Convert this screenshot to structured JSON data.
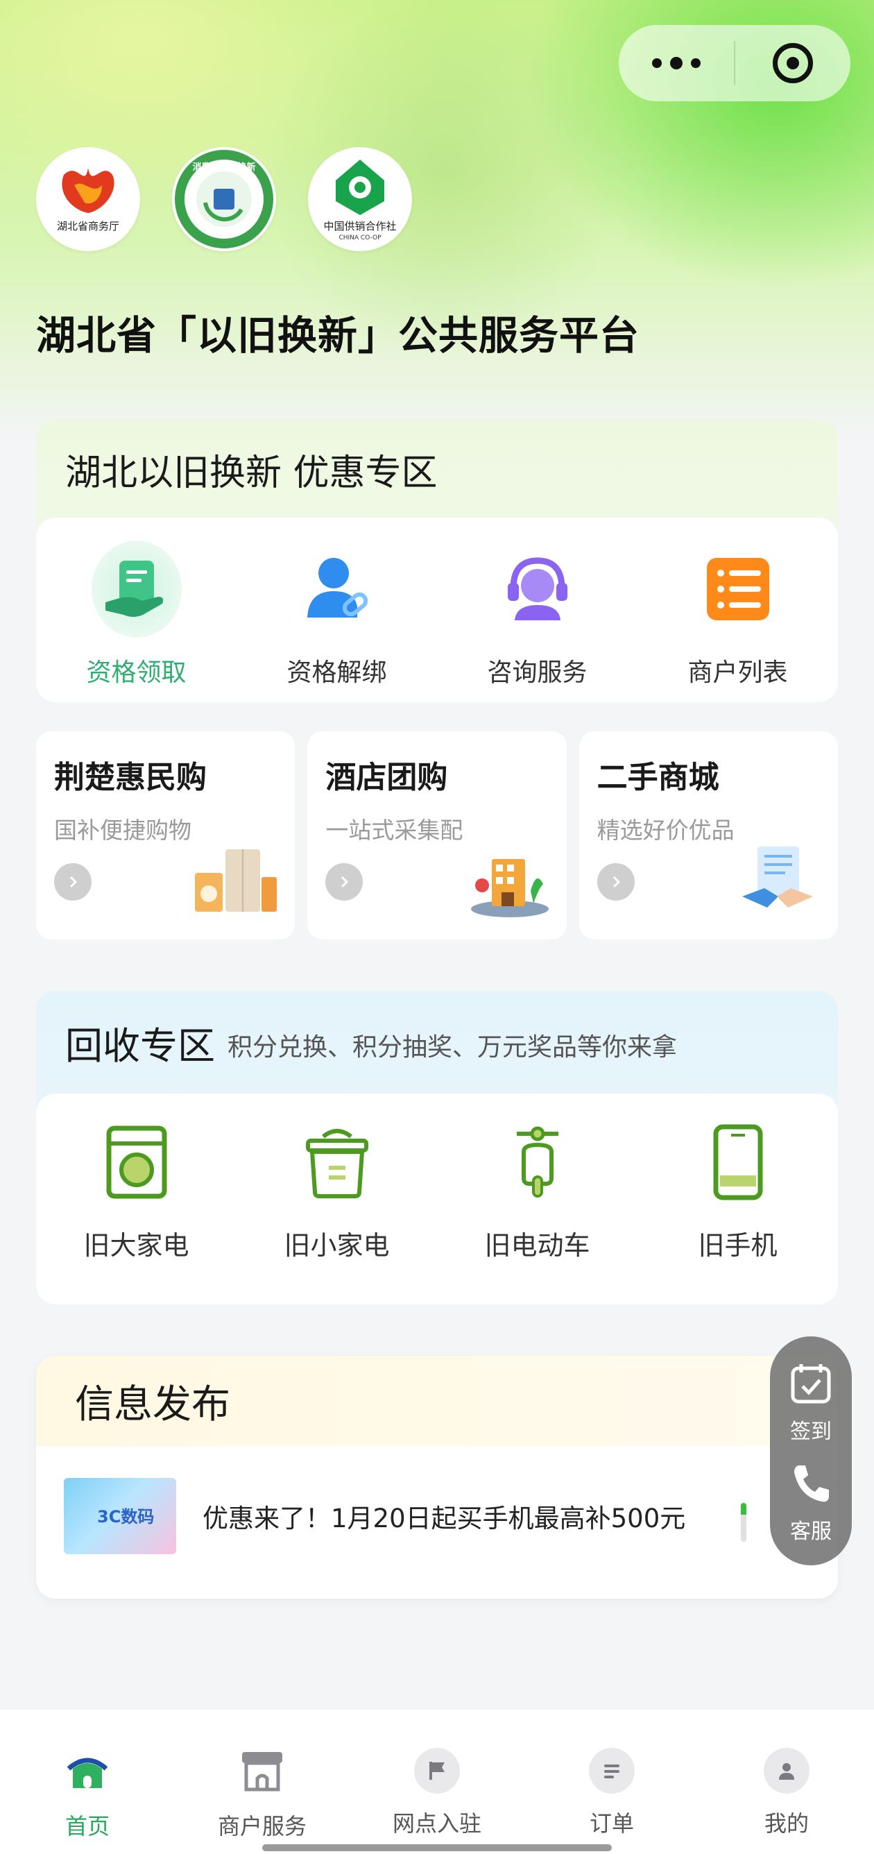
{
  "header": {
    "site_title": "湖北省「以旧换新」公共服务平台",
    "logos": [
      {
        "name": "hubei-commerce-logo",
        "caption": "湖北省商务厅"
      },
      {
        "name": "trade-in-program-logo",
        "caption": "消费品以旧换新"
      },
      {
        "name": "china-coop-logo",
        "caption": "中国供销合作社",
        "sub": "CHINA CO-OP"
      }
    ]
  },
  "discount": {
    "title": "湖北以旧换新 优惠专区",
    "items": [
      {
        "label": "资格领取",
        "icon": "hand-card-icon",
        "active": true
      },
      {
        "label": "资格解绑",
        "icon": "user-link-icon"
      },
      {
        "label": "咨询服务",
        "icon": "headset-icon"
      },
      {
        "label": "商户列表",
        "icon": "list-icon"
      }
    ]
  },
  "tiles": [
    {
      "title": "荆楚惠民购",
      "subtitle": "国补便捷购物",
      "icon": "appliances-icon"
    },
    {
      "title": "酒店团购",
      "subtitle": "一站式采集配",
      "icon": "hotel-icon"
    },
    {
      "title": "二手商城",
      "subtitle": "精选好价优品",
      "icon": "handshake-icon"
    }
  ],
  "recycle": {
    "title": "回收专区",
    "subtitle": "积分兑换、积分抽奖、万元奖品等你来拿",
    "items": [
      {
        "label": "旧大家电",
        "icon": "washing-machine-icon"
      },
      {
        "label": "旧小家电",
        "icon": "rice-cooker-icon"
      },
      {
        "label": "旧电动车",
        "icon": "scooter-icon"
      },
      {
        "label": "旧手机",
        "icon": "phone-icon"
      }
    ]
  },
  "info": {
    "title": "信息发布",
    "thumb_label": "3C数码",
    "items": [
      {
        "text": "优惠来了！1月20日起买手机最高补500元"
      }
    ]
  },
  "float": {
    "checkin": "签到",
    "service": "客服"
  },
  "tabbar": [
    {
      "label": "首页",
      "icon": "home-icon",
      "active": true
    },
    {
      "label": "商户服务",
      "icon": "shop-icon"
    },
    {
      "label": "网点入驻",
      "icon": "flag-icon"
    },
    {
      "label": "订单",
      "icon": "order-icon"
    },
    {
      "label": "我的",
      "icon": "user-icon"
    }
  ],
  "colors": {
    "accent": "#2fae72",
    "tab_active": "#29a85c",
    "recycle_icon": "#4c9a1f"
  }
}
